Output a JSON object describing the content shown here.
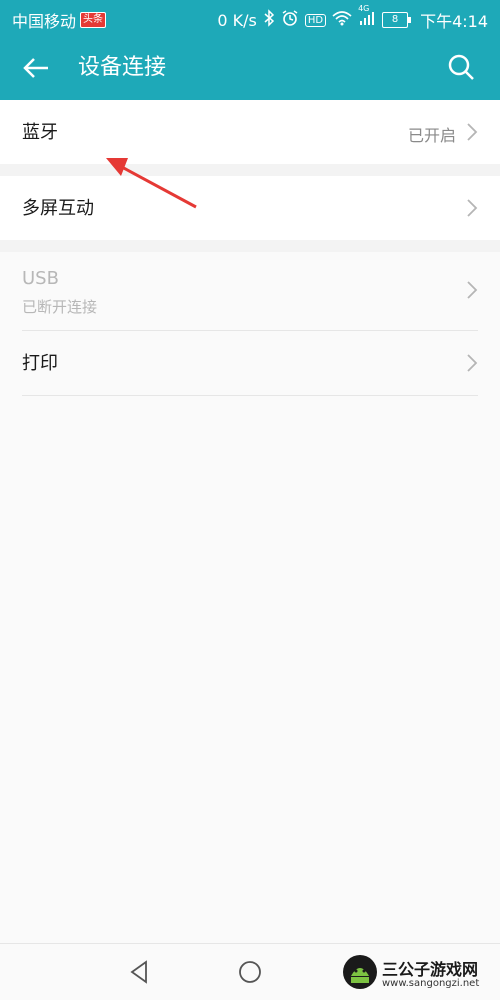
{
  "status_bar": {
    "carrier": "中国移动",
    "badge": "头条",
    "network_speed": "0 K/s",
    "signal_label": "4G",
    "hd_label": "HD",
    "battery": "8",
    "time": "下午4:14"
  },
  "app_bar": {
    "title": "设备连接"
  },
  "list": {
    "bluetooth": {
      "label": "蓝牙",
      "value": "已开启"
    },
    "multiscreen": {
      "label": "多屏互动"
    },
    "usb": {
      "label": "USB",
      "sub": "已断开连接"
    },
    "print": {
      "label": "打印"
    }
  },
  "watermark": {
    "text": "三公子游戏网",
    "url": "www.sangongzi.net"
  },
  "colors": {
    "primary": "#1ea9b8",
    "annotation_arrow": "#e53935"
  }
}
